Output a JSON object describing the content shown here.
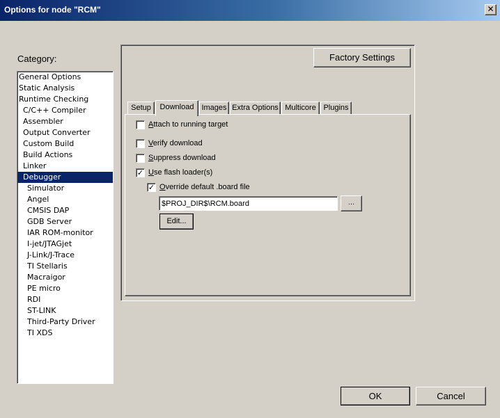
{
  "window": {
    "title": "Options for node \"RCM\"",
    "close_glyph": "✕"
  },
  "category": {
    "label": "Category:",
    "items": [
      {
        "label": "General Options",
        "level": 0,
        "selected": false
      },
      {
        "label": "Static Analysis",
        "level": 0,
        "selected": false
      },
      {
        "label": "Runtime Checking",
        "level": 0,
        "selected": false
      },
      {
        "label": "C/C++ Compiler",
        "level": 1,
        "selected": false
      },
      {
        "label": "Assembler",
        "level": 1,
        "selected": false
      },
      {
        "label": "Output Converter",
        "level": 1,
        "selected": false
      },
      {
        "label": "Custom Build",
        "level": 1,
        "selected": false
      },
      {
        "label": "Build Actions",
        "level": 1,
        "selected": false
      },
      {
        "label": "Linker",
        "level": 1,
        "selected": false
      },
      {
        "label": "Debugger",
        "level": 1,
        "selected": true
      },
      {
        "label": "Simulator",
        "level": 2,
        "selected": false
      },
      {
        "label": "Angel",
        "level": 2,
        "selected": false
      },
      {
        "label": "CMSIS DAP",
        "level": 2,
        "selected": false
      },
      {
        "label": "GDB Server",
        "level": 2,
        "selected": false
      },
      {
        "label": "IAR ROM-monitor",
        "level": 2,
        "selected": false
      },
      {
        "label": "I-jet/JTAGjet",
        "level": 2,
        "selected": false
      },
      {
        "label": "J-Link/J-Trace",
        "level": 2,
        "selected": false
      },
      {
        "label": "TI Stellaris",
        "level": 2,
        "selected": false
      },
      {
        "label": "Macraigor",
        "level": 2,
        "selected": false
      },
      {
        "label": "PE micro",
        "level": 2,
        "selected": false
      },
      {
        "label": "RDI",
        "level": 2,
        "selected": false
      },
      {
        "label": "ST-LINK",
        "level": 2,
        "selected": false
      },
      {
        "label": "Third-Party Driver",
        "level": 2,
        "selected": false
      },
      {
        "label": "TI XDS",
        "level": 2,
        "selected": false
      }
    ]
  },
  "factory_settings_label": "Factory Settings",
  "tabs": [
    {
      "label": "Setup",
      "active": false
    },
    {
      "label": "Download",
      "active": true
    },
    {
      "label": "Images",
      "active": false
    },
    {
      "label": "Extra Options",
      "active": false
    },
    {
      "label": "Multicore",
      "active": false
    },
    {
      "label": "Plugins",
      "active": false
    }
  ],
  "download": {
    "attach": {
      "label": "Attach to running target",
      "checked": false
    },
    "verify": {
      "label": "Verify download",
      "checked": false
    },
    "suppress": {
      "label": "Suppress download",
      "checked": false
    },
    "flash_loader": {
      "label": "Use flash loader(s)",
      "checked": true
    },
    "override_board": {
      "label": "Override default .board file",
      "checked": true
    },
    "board_file_value": "$PROJ_DIR$\\RCM.board",
    "browse_label": "...",
    "edit_label": "Edit..."
  },
  "check_glyph": "✓",
  "buttons": {
    "ok": "OK",
    "cancel": "Cancel"
  }
}
